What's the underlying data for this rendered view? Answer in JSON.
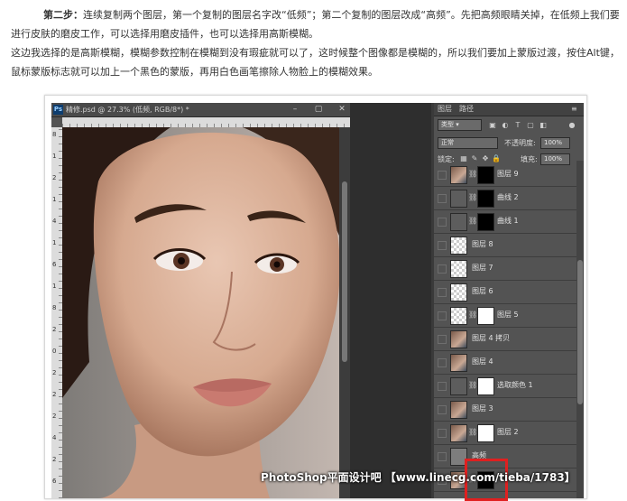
{
  "article": {
    "step_label": "第二步：",
    "para1_rest": "连续复制两个图层，第一个复制的图层名字改“低频”；第二个复制的图层改成“高频”。先把高频眼睛关掉，在低频上我们要进行皮肤的磨皮工作，可以选择用磨皮插件，也可以选择用高斯模糊。",
    "para2": "这边我选择的是高斯模糊，模糊参数控制在模糊到没有瑕疵就可以了，这时候整个图像都是模糊的，所以我们要加上蒙版过渡，按住Alt键，鼠标蒙版标志就可以加上一个黑色的蒙版，再用白色画笔擦除人物脸上的模糊效果。"
  },
  "photoshop": {
    "doc_title": "精修.psd @ 27.3% (低频, RGB/8*) *",
    "ps_badge": "Ps",
    "ruler_numbers": [
      "8",
      "1",
      "2",
      "1",
      "4",
      "1",
      "6",
      "1",
      "8",
      "2",
      "0",
      "2",
      "2",
      "2",
      "4",
      "2",
      "6"
    ],
    "layers_panel": {
      "tab_layers": "图层",
      "tab_paths": "路径",
      "kind_label": "类型",
      "blend_mode": "正常",
      "opacity_label": "不透明度:",
      "opacity_value": "100%",
      "lock_label": "锁定:",
      "fill_label": "填充:",
      "fill_value": "100%",
      "layers": [
        {
          "name": "图层 9",
          "thumb": "photo",
          "mask": "black"
        },
        {
          "name": "曲线 2",
          "thumb": "curve",
          "mask": "black"
        },
        {
          "name": "曲线 1",
          "thumb": "curve",
          "mask": "black"
        },
        {
          "name": "图层 8",
          "thumb": "trans",
          "mask": ""
        },
        {
          "name": "图层 7",
          "thumb": "trans",
          "mask": ""
        },
        {
          "name": "图层 6",
          "thumb": "trans",
          "mask": ""
        },
        {
          "name": "图层 5",
          "thumb": "trans",
          "mask": "white"
        },
        {
          "name": "图层 4 拷贝",
          "thumb": "photo",
          "mask": ""
        },
        {
          "name": "图层 4",
          "thumb": "photo",
          "mask": ""
        },
        {
          "name": "选取颜色 1",
          "thumb": "curve",
          "mask": "white"
        },
        {
          "name": "图层 3",
          "thumb": "photo",
          "mask": ""
        },
        {
          "name": "图层 2",
          "thumb": "photo",
          "mask": "white"
        },
        {
          "name": "高频",
          "thumb": "gray",
          "mask": ""
        },
        {
          "name": "",
          "thumb": "photo",
          "mask": "black"
        }
      ]
    }
  },
  "watermark": "PhotoShop平面设计吧 【www.linecg.com/tieba/1783】"
}
